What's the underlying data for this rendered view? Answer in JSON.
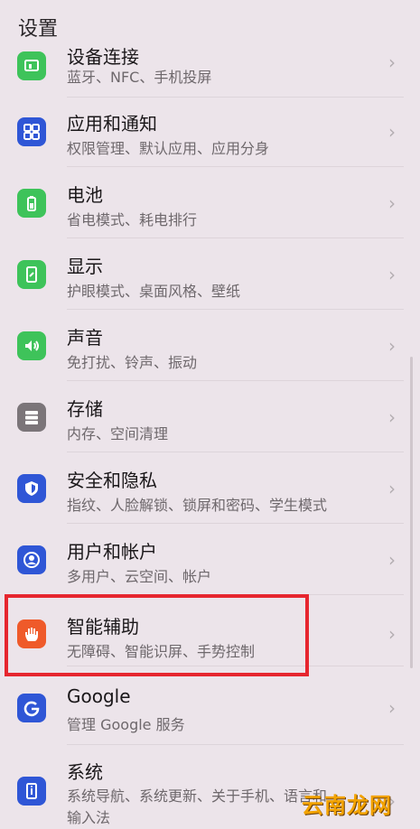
{
  "header": {
    "title": "设置"
  },
  "chevron": "›",
  "rows": [
    {
      "title": "设备连接",
      "subtitle": "蓝牙、NFC、手机投屏",
      "icon": "device-connect-icon",
      "color": "#3ec35a"
    },
    {
      "title": "应用和通知",
      "subtitle": "权限管理、默认应用、应用分身",
      "icon": "apps-icon",
      "color": "#2f56d6"
    },
    {
      "title": "电池",
      "subtitle": "省电模式、耗电排行",
      "icon": "battery-icon",
      "color": "#3ec35a"
    },
    {
      "title": "显示",
      "subtitle": "护眼模式、桌面风格、壁纸",
      "icon": "display-icon",
      "color": "#3ec35a"
    },
    {
      "title": "声音",
      "subtitle": "免打扰、铃声、振动",
      "icon": "sound-icon",
      "color": "#3ec35a"
    },
    {
      "title": "存储",
      "subtitle": "内存、空间清理",
      "icon": "storage-icon",
      "color": "#7b7579"
    },
    {
      "title": "安全和隐私",
      "subtitle": "指纹、人脸解锁、锁屏和密码、学生模式",
      "icon": "security-shield-icon",
      "color": "#2f56d6"
    },
    {
      "title": "用户和帐户",
      "subtitle": "多用户、云空间、帐户",
      "icon": "user-icon",
      "color": "#2f56d6"
    },
    {
      "title": "智能辅助",
      "subtitle": "无障碍、智能识屏、手势控制",
      "icon": "hand-icon",
      "color": "#ef5a2a"
    },
    {
      "title": "Google",
      "subtitle": "管理 Google 服务",
      "icon": "google-icon",
      "color": "#2f56d6"
    },
    {
      "title": "系统",
      "subtitle": "系统导航、系统更新、关于手机、语言和输入法",
      "icon": "system-phone-icon",
      "color": "#2f56d6"
    }
  ],
  "watermark": "云南龙网"
}
